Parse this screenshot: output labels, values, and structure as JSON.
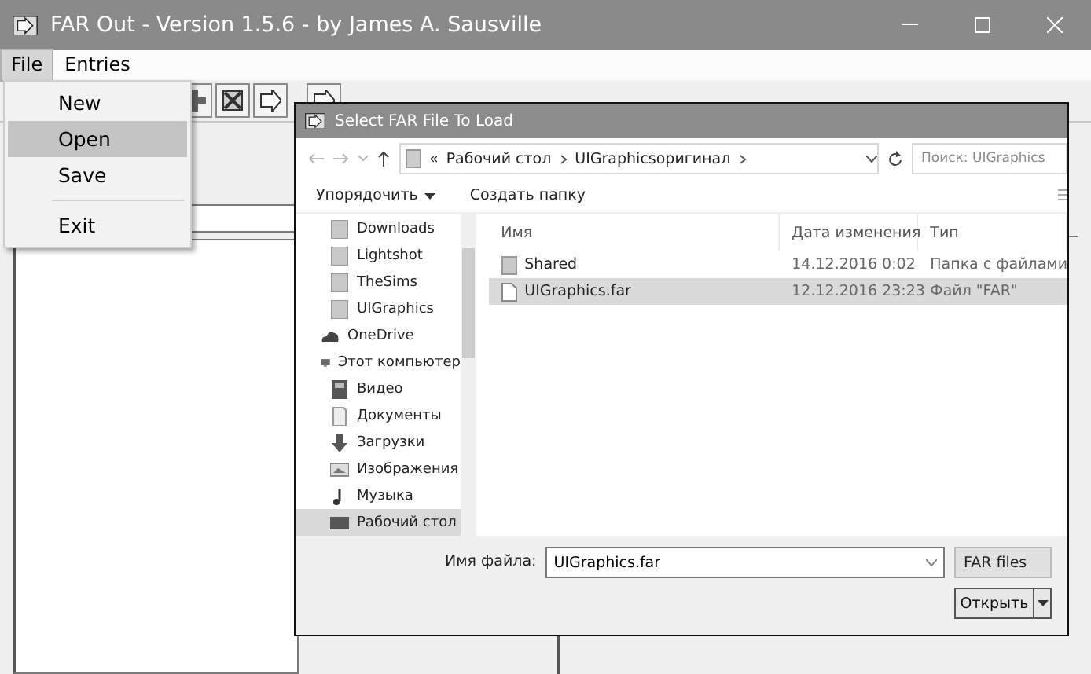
{
  "window": {
    "title": "FAR Out - Version 1.5.6 - by James A. Sausville"
  },
  "menu_bar": [
    {
      "label": "File",
      "selected": true
    },
    {
      "label": "Entries",
      "selected": false
    }
  ],
  "file_menu": [
    {
      "kind": "item",
      "label": "New",
      "selected": false
    },
    {
      "kind": "item",
      "label": "Open",
      "selected": true
    },
    {
      "kind": "item",
      "label": "Save",
      "selected": false
    },
    {
      "kind": "separator"
    },
    {
      "kind": "item",
      "label": "Exit",
      "selected": false
    }
  ],
  "dialog": {
    "title": "Select FAR File To Load",
    "address": {
      "overflow": "«",
      "path": [
        "Рабочий стол",
        "UIGraphicsоригинал"
      ]
    },
    "search": {
      "placeholder": "Поиск: UIGraphics"
    },
    "commands": [
      {
        "label": "Упорядочить",
        "dropdown": true
      },
      {
        "label": "Создать папку",
        "dropdown": false
      }
    ],
    "nav_items": [
      {
        "kind": "folder",
        "label": "Downloads",
        "selected": false
      },
      {
        "kind": "folder",
        "label": "Lightshot",
        "selected": false
      },
      {
        "kind": "folder",
        "label": "TheSims",
        "selected": false
      },
      {
        "kind": "folder",
        "label": "UIGraphics",
        "selected": false
      },
      {
        "kind": "cloud",
        "label": "OneDrive",
        "selected": false
      },
      {
        "kind": "computer",
        "label": "Этот компьютер",
        "selected": false
      },
      {
        "kind": "video",
        "label": "Видео",
        "selected": false
      },
      {
        "kind": "document",
        "label": "Документы",
        "selected": false
      },
      {
        "kind": "download",
        "label": "Загрузки",
        "selected": false
      },
      {
        "kind": "image",
        "label": "Изображения",
        "selected": false
      },
      {
        "kind": "music",
        "label": "Музыка",
        "selected": false
      },
      {
        "kind": "desktop",
        "label": "Рабочий стол",
        "selected": true
      }
    ],
    "columns": [
      "Имя",
      "Дата изменения",
      "Тип"
    ],
    "files": [
      {
        "kind": "folder",
        "name": "Shared",
        "date": "14.12.2016 0:02",
        "type": "Папка с файлами",
        "selected": false
      },
      {
        "kind": "file",
        "name": "UIGraphics.far",
        "date": "12.12.2016 23:23",
        "type": "Файл \"FAR\"",
        "selected": true
      }
    ],
    "filename_label": "Имя файла:",
    "filename": "UIGraphics.far",
    "filter": "FAR files",
    "open_button": "Открыть"
  }
}
